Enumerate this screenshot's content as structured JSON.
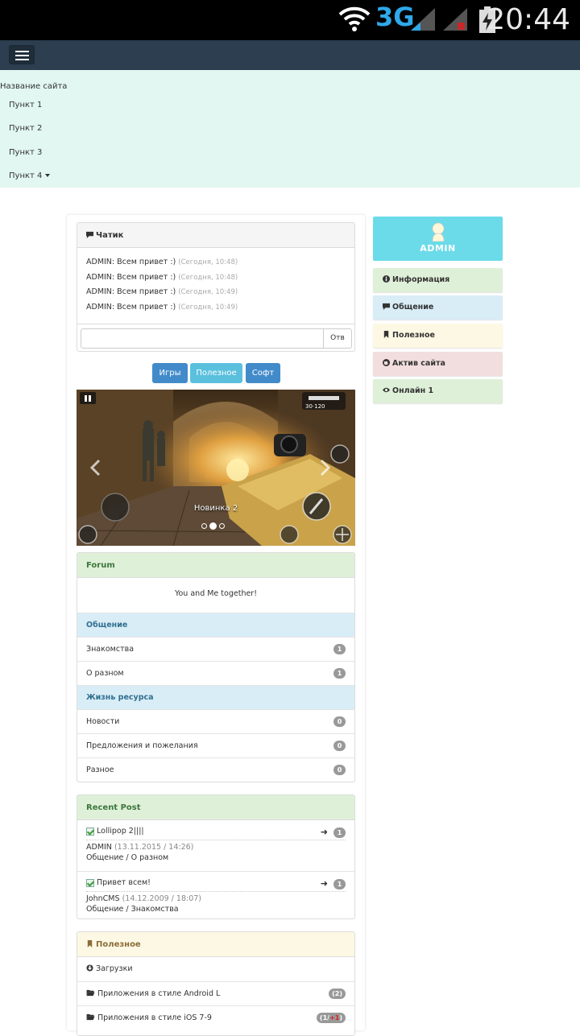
{
  "status_bar": {
    "network": "3G",
    "time": "20:44"
  },
  "nav": {
    "brand": "Название сайта",
    "items": [
      "Пункт 1",
      "Пункт 2",
      "Пункт 3",
      "Пункт 4"
    ]
  },
  "chat": {
    "title": "Чатик",
    "messages": [
      {
        "text": "ADMIN: Всем привет :)",
        "when": "(Сегодня, 10:48)"
      },
      {
        "text": "ADMIN: Всем привет :)",
        "when": "(Сегодня, 10:48)"
      },
      {
        "text": "ADMIN: Всем привет :)",
        "when": "(Сегодня, 10:49)"
      },
      {
        "text": "ADMIN: Всем привет :)",
        "when": "(Сегодня, 10:49)"
      }
    ],
    "input_value": "",
    "send_label": "Отв"
  },
  "buttons": {
    "games": "Игры",
    "useful": "Полезное",
    "soft": "Софт"
  },
  "carousel": {
    "caption": "Новинка 2",
    "hud_ammo": "30·120"
  },
  "forum": {
    "title": "Forum",
    "subtitle": "You and Me together!",
    "sections": [
      {
        "title": "Общение",
        "items": [
          {
            "label": "Знакомства",
            "count": "1"
          },
          {
            "label": "О разном",
            "count": "1"
          }
        ]
      },
      {
        "title": "Жизнь ресурса",
        "items": [
          {
            "label": "Новости",
            "count": "0"
          },
          {
            "label": "Предложения и пожелания",
            "count": "0"
          },
          {
            "label": "Разное",
            "count": "0"
          }
        ]
      }
    ]
  },
  "recent": {
    "title": "Recent Post",
    "posts": [
      {
        "title": "Lollipop 2||||",
        "count": "1",
        "author": "ADMIN",
        "date": "(13.11.2015 / 14:26)",
        "category": "Общение / О разном"
      },
      {
        "title": "Привет всем!",
        "count": "1",
        "author": "JohnCMS",
        "date": "(14.12.2009 / 18:07)",
        "category": "Общение / Знакомства"
      }
    ]
  },
  "useful": {
    "title": "Полезное",
    "items": [
      {
        "label": "Загрузки",
        "count": ""
      },
      {
        "label": "Приложения в стиле Android L",
        "count": "(2)"
      },
      {
        "label": "Приложения в стиле iOS 7-9",
        "count": "(1/",
        "new": "+1",
        "close": ")"
      }
    ]
  },
  "sidebar": {
    "user": "ADMIN",
    "items": [
      {
        "label": "Информация",
        "color": "#dff0d8",
        "icon": "info-icon"
      },
      {
        "label": "Общение",
        "color": "#d9edf7",
        "icon": "comment-icon"
      },
      {
        "label": "Полезное",
        "color": "#fcf8e3",
        "icon": "bookmark-icon"
      },
      {
        "label": "Актив сайта",
        "color": "#f2dede",
        "icon": "globe-icon"
      },
      {
        "label": "Онлайн 1",
        "color": "#dff0d8",
        "icon": "eye-icon"
      }
    ]
  },
  "colors": {
    "navbar": "#2c3e50",
    "menu_bg": "#e2f7f1",
    "btn_primary": "#428bca",
    "btn_info": "#5bc0de",
    "admin_box": "#6bdbe9"
  }
}
